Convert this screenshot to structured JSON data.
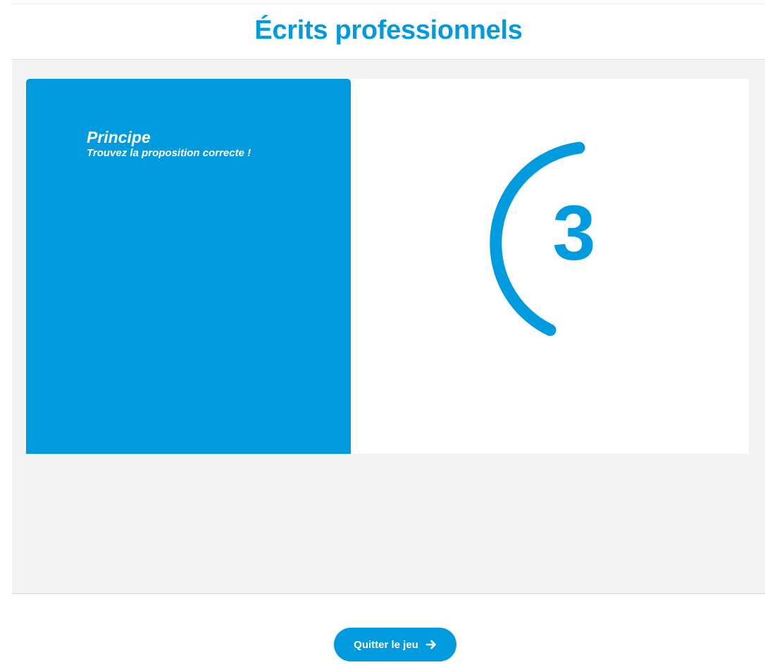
{
  "header": {
    "title": "Écrits professionnels"
  },
  "instructions": {
    "title": "Principe",
    "text": "Trouvez la proposition correcte !"
  },
  "countdown": {
    "value": "3"
  },
  "footer": {
    "quit_label": "Quitter le jeu",
    "quit_icon": "arrow-right-icon"
  },
  "colors": {
    "accent": "#009ade",
    "background": "#f3f3f3",
    "surface": "#ffffff"
  }
}
